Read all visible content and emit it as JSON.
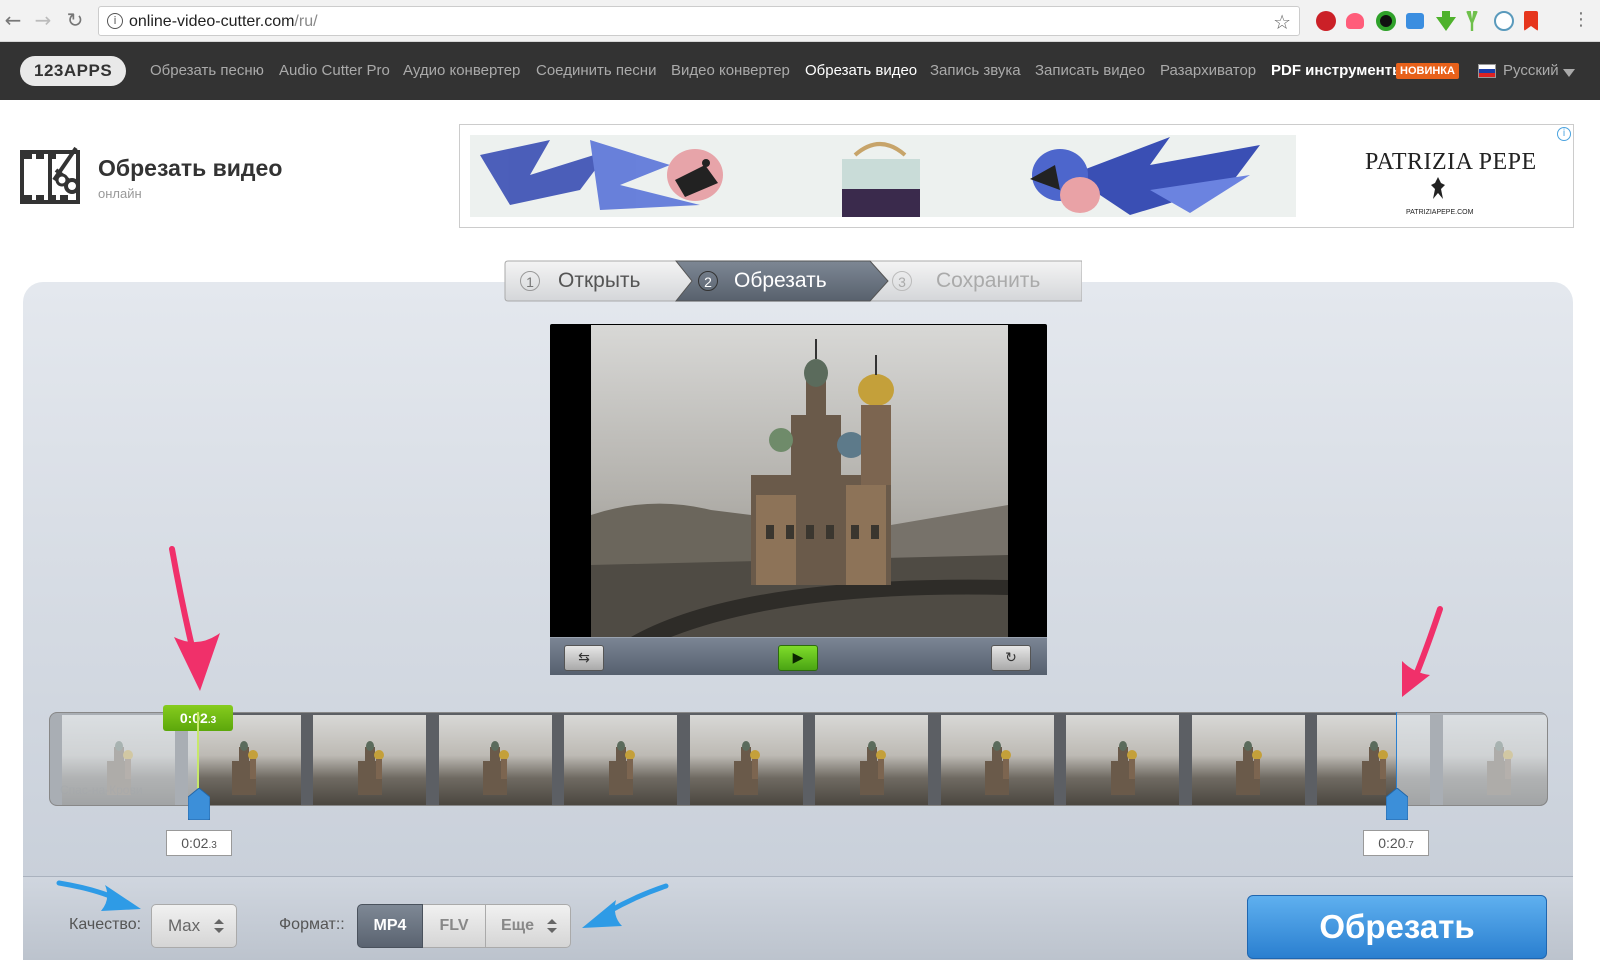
{
  "browser": {
    "url_host": "online-video-cutter.com",
    "url_path": "/ru/",
    "back_icon": "back-arrow-icon",
    "forward_icon": "forward-arrow-icon",
    "reload_icon": "reload-icon"
  },
  "nav": {
    "logo": "123APPS",
    "items": [
      "Обрезать песню",
      "Audio Cutter Pro",
      "Аудио конвертер",
      "Соединить песни",
      "Видео конвертер",
      "Обрезать видео",
      "Запись звука",
      "Записать видео",
      "Разархиватор"
    ],
    "active_index": 5,
    "pdf": "PDF инструменты",
    "badge": "НОВИНКА",
    "language": "Русский"
  },
  "header": {
    "title": "Обрезать видео",
    "subtitle": "онлайн"
  },
  "ad": {
    "brand": "PATRIZIA PEPE",
    "brand_url": "PATRIZIAPEPE.COM"
  },
  "steps": [
    {
      "num": "1",
      "label": "Открыть",
      "state": "done"
    },
    {
      "num": "2",
      "label": "Обрезать",
      "state": "active"
    },
    {
      "num": "3",
      "label": "Сохранить",
      "state": "pending"
    }
  ],
  "player": {
    "crop_icon": "crop-icon",
    "play_icon": "play-icon",
    "rotate_icon": "rotate-icon"
  },
  "timeline": {
    "current_time": "0:02",
    "current_time_fraction": ".3",
    "start_time": "0:02",
    "start_fraction": ".3",
    "end_time": "0:20",
    "end_fraction": ".7",
    "thumbnail_count": 12,
    "thumbnail_caption": "Спас-на-Крови"
  },
  "settings": {
    "quality_label": "Качество:",
    "quality_value": "Max",
    "format_label": "Формат::",
    "formats": [
      "MP4",
      "FLV",
      "Еще"
    ],
    "active_format": "MP4"
  },
  "actions": {
    "cut": "Обрезать"
  },
  "colors": {
    "accent_green": "#5ca70b",
    "accent_blue": "#2a7fd0",
    "annotation_pink": "#f0306a",
    "annotation_blue": "#2e9be6"
  }
}
